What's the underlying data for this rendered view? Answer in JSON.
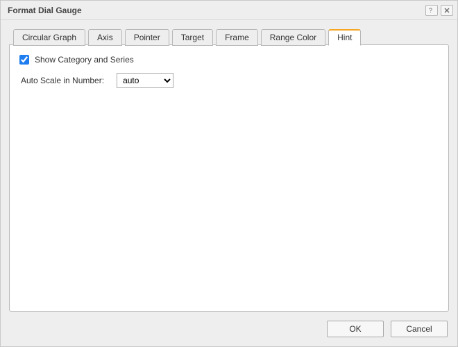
{
  "title": "Format Dial Gauge",
  "tabs": [
    {
      "label": "Circular Graph"
    },
    {
      "label": "Axis"
    },
    {
      "label": "Pointer"
    },
    {
      "label": "Target"
    },
    {
      "label": "Frame"
    },
    {
      "label": "Range Color"
    },
    {
      "label": "Hint"
    }
  ],
  "active_tab_index": 6,
  "hint": {
    "show_category_and_series_label": "Show Category and Series",
    "show_category_and_series_checked": true,
    "auto_scale_label": "Auto Scale in Number:",
    "auto_scale_value": "auto"
  },
  "buttons": {
    "ok": "OK",
    "cancel": "Cancel"
  }
}
